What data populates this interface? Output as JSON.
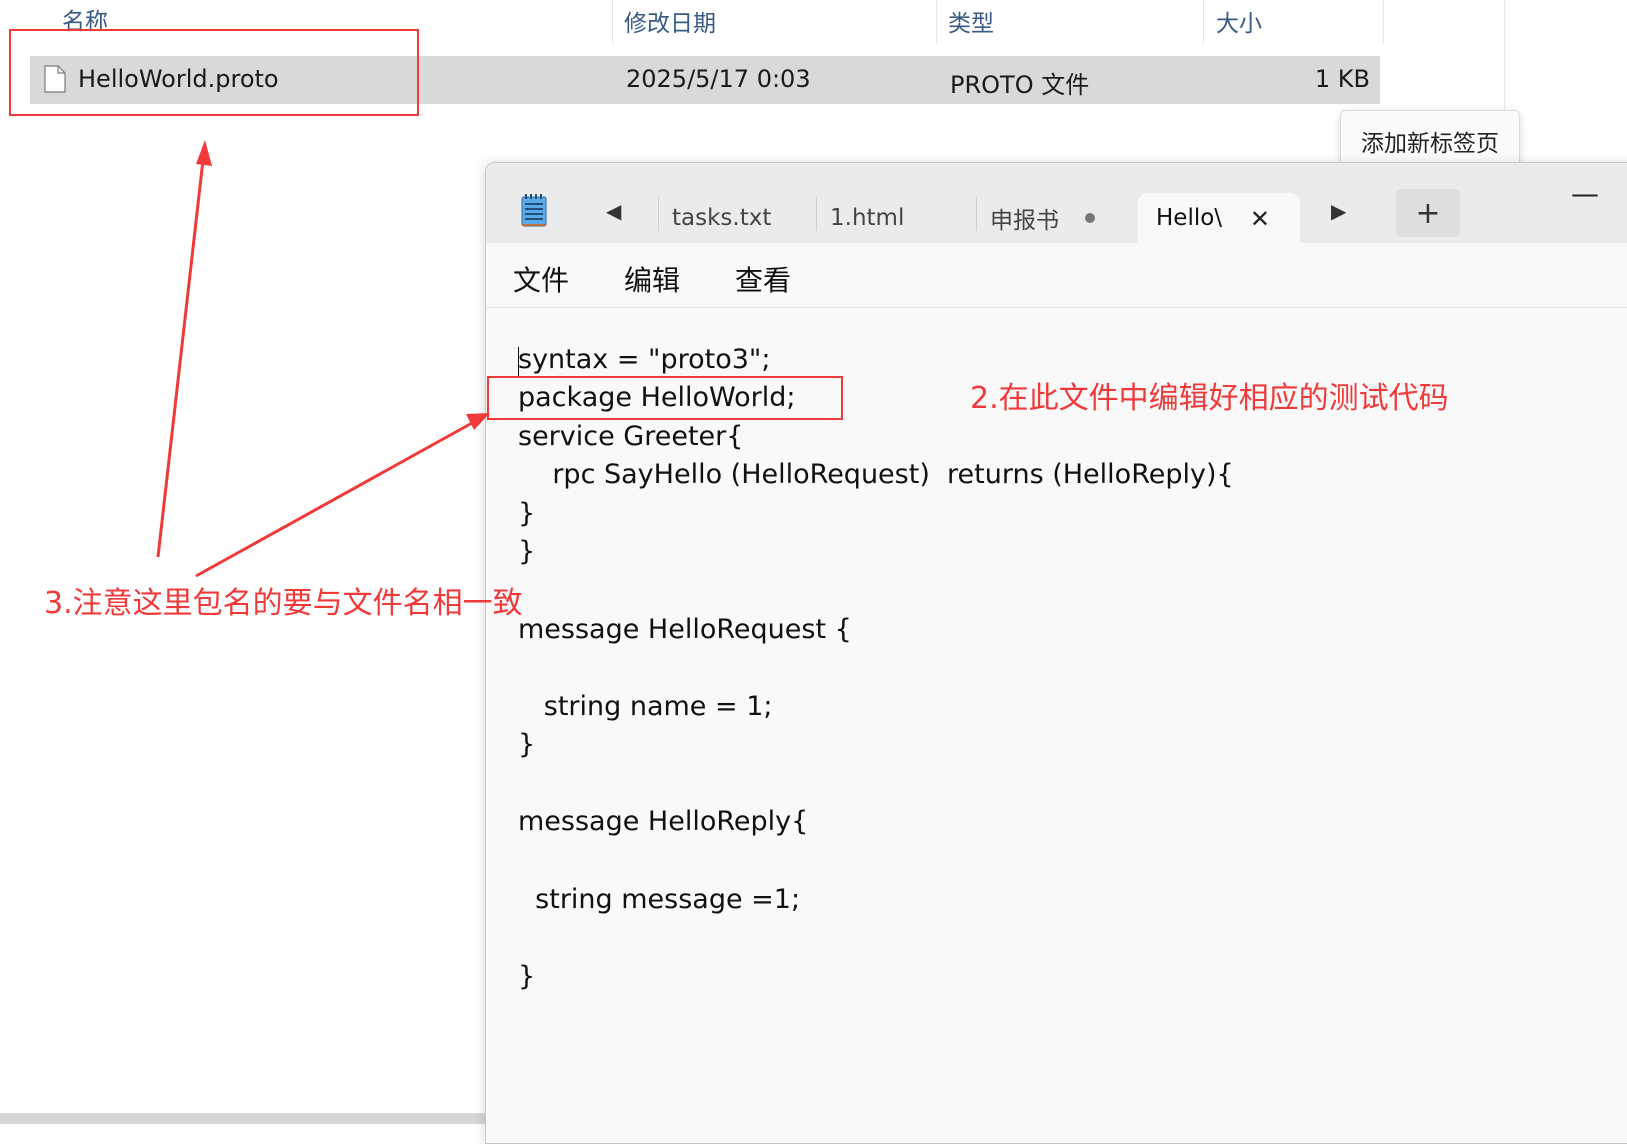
{
  "explorer": {
    "columns": {
      "name": "名称",
      "modified": "修改日期",
      "type": "类型",
      "size": "大小"
    },
    "file": {
      "name": "HelloWorld.proto",
      "modified": "2025/5/17 0:03",
      "type": "PROTO 文件",
      "size": "1 KB"
    }
  },
  "tooltip": {
    "text": "添加新标签页"
  },
  "notepad": {
    "tabs": [
      {
        "label": "tasks.txt"
      },
      {
        "label": "1.html"
      },
      {
        "label": "申报书"
      },
      {
        "label": "Hello\\"
      }
    ],
    "new_tab": "+",
    "minimize": "—",
    "menu": {
      "file": "文件",
      "edit": "编辑",
      "view": "查看"
    },
    "code": [
      "syntax = \"proto3\";",
      "package HelloWorld;",
      "service Greeter{",
      "    rpc SayHello (HelloRequest)  returns (HelloReply){",
      "}",
      "}",
      "",
      "message HelloRequest {",
      "",
      "   string name = 1;",
      "}",
      "",
      "message HelloReply{",
      "",
      "  string message =1;",
      "",
      "}"
    ]
  },
  "annotations": {
    "note_2": "2.在此文件中编辑好相应的测试代码",
    "note_3": "3.注意这里包名的要与文件名相一致",
    "color": "#f03a3a"
  }
}
